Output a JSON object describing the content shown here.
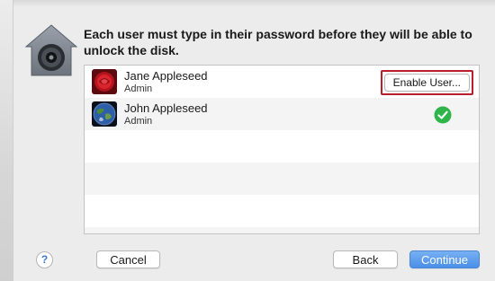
{
  "dialog": {
    "headline": "Each user must type in their password before they will be able to unlock the disk."
  },
  "users": [
    {
      "name": "Jane Appleseed",
      "role": "Admin",
      "action_label": "Enable User...",
      "avatar_icon": "red-rose-icon"
    },
    {
      "name": "John Appleseed",
      "role": "Admin",
      "status_icon": "green-checkmark-icon",
      "avatar_icon": "earth-icon"
    }
  ],
  "footer": {
    "help_label": "?",
    "cancel_label": "Cancel",
    "back_label": "Back",
    "continue_label": "Continue"
  },
  "colors": {
    "highlight_border": "#b81e2c",
    "primary_button": "#4a8fe8",
    "check_green": "#2fb44a"
  }
}
